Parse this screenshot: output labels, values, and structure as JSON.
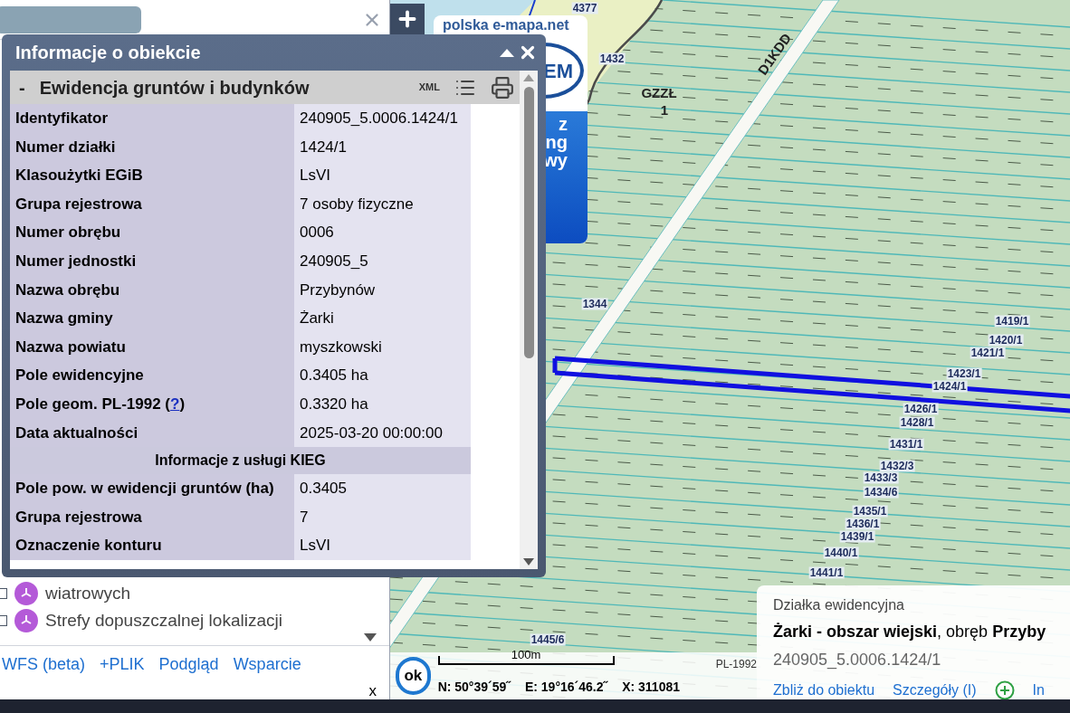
{
  "sidebar": {
    "layers": [
      {
        "text": "wiatrowych",
        "checked": false
      },
      {
        "text": "Strefy dopuszczalnej lokalizacji",
        "checked": false
      }
    ],
    "links": [
      "WFS (beta)",
      "+PLIK",
      "Podgląd",
      "Wsparcie"
    ],
    "close": "x"
  },
  "ad": {
    "site": "polska e-mapa.net",
    "logo": "EM",
    "banner_lines": [
      "z",
      "ng",
      "wy"
    ]
  },
  "dialog": {
    "title": "Informacje o obiekcie",
    "section": {
      "toggle": "-",
      "title": "Ewidencja gruntów i budynków",
      "xml": "XML"
    },
    "rows": [
      {
        "kind": "row",
        "label": "Identyfikator",
        "value": "240905_5.0006.1424/1"
      },
      {
        "kind": "row",
        "label": "Numer działki",
        "value": "1424/1"
      },
      {
        "kind": "row",
        "label": "Klasoużytki EGiB",
        "value": "LsVI"
      },
      {
        "kind": "row",
        "label": "Grupa rejestrowa",
        "value": "7 osoby fizyczne"
      },
      {
        "kind": "row",
        "label": "Numer obrębu",
        "value": "0006"
      },
      {
        "kind": "row",
        "label": "Numer jednostki",
        "value": "240905_5"
      },
      {
        "kind": "row",
        "label": "Nazwa obrębu",
        "value": "Przybynów"
      },
      {
        "kind": "row",
        "label": "Nazwa gminy",
        "value": "Żarki"
      },
      {
        "kind": "row",
        "label": "Nazwa powiatu",
        "value": "myszkowski"
      },
      {
        "kind": "row",
        "label": "Pole ewidencyjne",
        "value": "0.3405 ha"
      },
      {
        "kind": "help",
        "label": "Pole geom. PL-1992 (",
        "link": "?",
        "label_end": ")",
        "value": "0.3320 ha"
      },
      {
        "kind": "row",
        "label": "Data aktualności",
        "value": "2025-03-20 00:00:00"
      },
      {
        "kind": "section",
        "label": "Informacje z usługi KIEG"
      },
      {
        "kind": "row",
        "label": "Pole pow. w ewidencji gruntów (ha)",
        "value": "0.3405"
      },
      {
        "kind": "row",
        "label": "Grupa rejestrowa",
        "value": "7"
      },
      {
        "kind": "row",
        "label": "Oznaczenie konturu",
        "value": "LsVI"
      }
    ]
  },
  "map": {
    "labels": [
      {
        "text": "4377"
      },
      {
        "text": "1432"
      },
      {
        "text": "GZZŁ"
      },
      {
        "text": "1"
      },
      {
        "text": "D1KDD"
      },
      {
        "text": "1344"
      },
      {
        "text": "1419/1"
      },
      {
        "text": "1420/1"
      },
      {
        "text": "1421/1"
      },
      {
        "text": "1423/1"
      },
      {
        "text": "1424/1"
      },
      {
        "text": "1426/1"
      },
      {
        "text": "1428/1"
      },
      {
        "text": "1431/1"
      },
      {
        "text": "1432/3"
      },
      {
        "text": "1433/3"
      },
      {
        "text": "1434/6"
      },
      {
        "text": "1435/1"
      },
      {
        "text": "1436/1"
      },
      {
        "text": "1439/1"
      },
      {
        "text": "1440/1"
      },
      {
        "text": "1441/1"
      },
      {
        "text": "1445/6"
      }
    ]
  },
  "map_footer": {
    "ok": "ok",
    "scale": "100m",
    "crs": "PL-1992",
    "coords": [
      "N: 50°39´59˝",
      "E: 19°16´46.2˝",
      "X: 311081"
    ]
  },
  "info_card": {
    "heading": "Działka ewidencyjna",
    "line": "**Żarki - obszar wiejski**, obręb **Przyby**",
    "id": "240905_5.0006.1424/1",
    "actions": [
      "Zbliż do obiektu",
      "Szczegóły (I)"
    ],
    "more": "In"
  }
}
